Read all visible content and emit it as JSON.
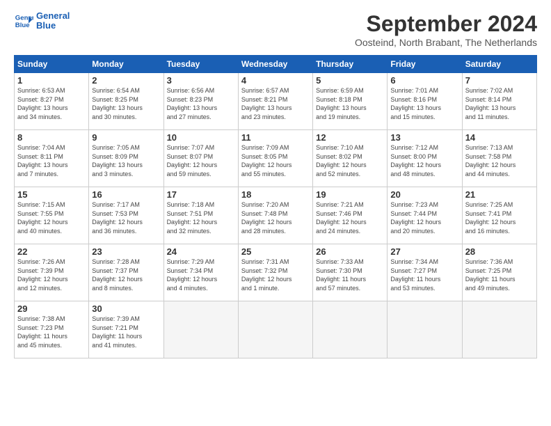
{
  "logo": {
    "line1": "General",
    "line2": "Blue"
  },
  "title": "September 2024",
  "subtitle": "Oosteind, North Brabant, The Netherlands",
  "weekdays": [
    "Sunday",
    "Monday",
    "Tuesday",
    "Wednesday",
    "Thursday",
    "Friday",
    "Saturday"
  ],
  "weeks": [
    [
      {
        "day": "1",
        "info": "Sunrise: 6:53 AM\nSunset: 8:27 PM\nDaylight: 13 hours\nand 34 minutes."
      },
      {
        "day": "2",
        "info": "Sunrise: 6:54 AM\nSunset: 8:25 PM\nDaylight: 13 hours\nand 30 minutes."
      },
      {
        "day": "3",
        "info": "Sunrise: 6:56 AM\nSunset: 8:23 PM\nDaylight: 13 hours\nand 27 minutes."
      },
      {
        "day": "4",
        "info": "Sunrise: 6:57 AM\nSunset: 8:21 PM\nDaylight: 13 hours\nand 23 minutes."
      },
      {
        "day": "5",
        "info": "Sunrise: 6:59 AM\nSunset: 8:18 PM\nDaylight: 13 hours\nand 19 minutes."
      },
      {
        "day": "6",
        "info": "Sunrise: 7:01 AM\nSunset: 8:16 PM\nDaylight: 13 hours\nand 15 minutes."
      },
      {
        "day": "7",
        "info": "Sunrise: 7:02 AM\nSunset: 8:14 PM\nDaylight: 13 hours\nand 11 minutes."
      }
    ],
    [
      {
        "day": "8",
        "info": "Sunrise: 7:04 AM\nSunset: 8:11 PM\nDaylight: 13 hours\nand 7 minutes."
      },
      {
        "day": "9",
        "info": "Sunrise: 7:05 AM\nSunset: 8:09 PM\nDaylight: 13 hours\nand 3 minutes."
      },
      {
        "day": "10",
        "info": "Sunrise: 7:07 AM\nSunset: 8:07 PM\nDaylight: 12 hours\nand 59 minutes."
      },
      {
        "day": "11",
        "info": "Sunrise: 7:09 AM\nSunset: 8:05 PM\nDaylight: 12 hours\nand 55 minutes."
      },
      {
        "day": "12",
        "info": "Sunrise: 7:10 AM\nSunset: 8:02 PM\nDaylight: 12 hours\nand 52 minutes."
      },
      {
        "day": "13",
        "info": "Sunrise: 7:12 AM\nSunset: 8:00 PM\nDaylight: 12 hours\nand 48 minutes."
      },
      {
        "day": "14",
        "info": "Sunrise: 7:13 AM\nSunset: 7:58 PM\nDaylight: 12 hours\nand 44 minutes."
      }
    ],
    [
      {
        "day": "15",
        "info": "Sunrise: 7:15 AM\nSunset: 7:55 PM\nDaylight: 12 hours\nand 40 minutes."
      },
      {
        "day": "16",
        "info": "Sunrise: 7:17 AM\nSunset: 7:53 PM\nDaylight: 12 hours\nand 36 minutes."
      },
      {
        "day": "17",
        "info": "Sunrise: 7:18 AM\nSunset: 7:51 PM\nDaylight: 12 hours\nand 32 minutes."
      },
      {
        "day": "18",
        "info": "Sunrise: 7:20 AM\nSunset: 7:48 PM\nDaylight: 12 hours\nand 28 minutes."
      },
      {
        "day": "19",
        "info": "Sunrise: 7:21 AM\nSunset: 7:46 PM\nDaylight: 12 hours\nand 24 minutes."
      },
      {
        "day": "20",
        "info": "Sunrise: 7:23 AM\nSunset: 7:44 PM\nDaylight: 12 hours\nand 20 minutes."
      },
      {
        "day": "21",
        "info": "Sunrise: 7:25 AM\nSunset: 7:41 PM\nDaylight: 12 hours\nand 16 minutes."
      }
    ],
    [
      {
        "day": "22",
        "info": "Sunrise: 7:26 AM\nSunset: 7:39 PM\nDaylight: 12 hours\nand 12 minutes."
      },
      {
        "day": "23",
        "info": "Sunrise: 7:28 AM\nSunset: 7:37 PM\nDaylight: 12 hours\nand 8 minutes."
      },
      {
        "day": "24",
        "info": "Sunrise: 7:29 AM\nSunset: 7:34 PM\nDaylight: 12 hours\nand 4 minutes."
      },
      {
        "day": "25",
        "info": "Sunrise: 7:31 AM\nSunset: 7:32 PM\nDaylight: 12 hours\nand 1 minute."
      },
      {
        "day": "26",
        "info": "Sunrise: 7:33 AM\nSunset: 7:30 PM\nDaylight: 11 hours\nand 57 minutes."
      },
      {
        "day": "27",
        "info": "Sunrise: 7:34 AM\nSunset: 7:27 PM\nDaylight: 11 hours\nand 53 minutes."
      },
      {
        "day": "28",
        "info": "Sunrise: 7:36 AM\nSunset: 7:25 PM\nDaylight: 11 hours\nand 49 minutes."
      }
    ],
    [
      {
        "day": "29",
        "info": "Sunrise: 7:38 AM\nSunset: 7:23 PM\nDaylight: 11 hours\nand 45 minutes."
      },
      {
        "day": "30",
        "info": "Sunrise: 7:39 AM\nSunset: 7:21 PM\nDaylight: 11 hours\nand 41 minutes."
      },
      {
        "day": "",
        "info": ""
      },
      {
        "day": "",
        "info": ""
      },
      {
        "day": "",
        "info": ""
      },
      {
        "day": "",
        "info": ""
      },
      {
        "day": "",
        "info": ""
      }
    ]
  ]
}
